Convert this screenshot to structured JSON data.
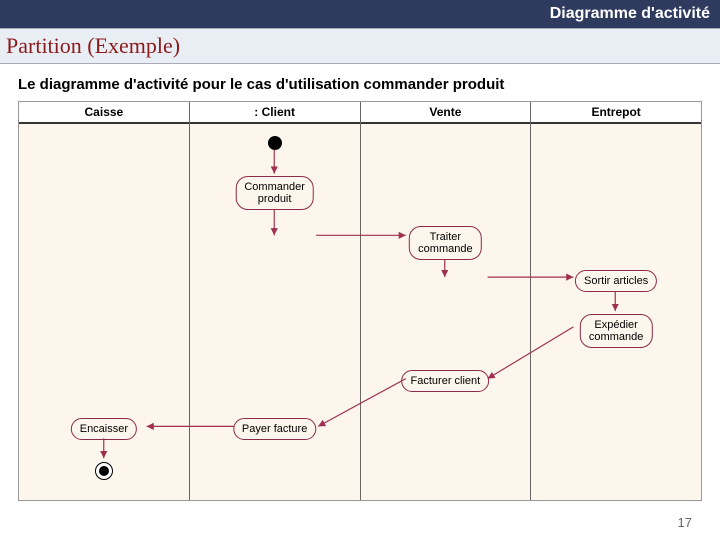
{
  "header": {
    "top_right": "Diagramme d'activité",
    "title": "Partition (Exemple)"
  },
  "subtitle": "Le diagramme d'activité pour le cas d'utilisation commander produit",
  "lanes": {
    "l0": "Caisse",
    "l1": ": Client",
    "l2": "Vente",
    "l3": "Entrepot"
  },
  "activities": {
    "commander": "Commander\nproduit",
    "traiter": "Traiter\ncommande",
    "sortir": "Sortir articles",
    "expedier": "Expédier\ncommande",
    "facturer": "Facturer client",
    "payer": "Payer facture",
    "encaisser": "Encaisser"
  },
  "page_number": "17",
  "diagram": {
    "description": "UML activity diagram with 4 swimlanes showing order processing flow",
    "flow": [
      [
        "start",
        "Client"
      ],
      [
        "Commander produit",
        "Client"
      ],
      [
        "Traiter commande",
        "Vente"
      ],
      [
        "Sortir articles",
        "Entrepot"
      ],
      [
        "Expédier commande",
        "Entrepot"
      ],
      [
        "Facturer client",
        "Vente"
      ],
      [
        "Payer facture",
        "Client"
      ],
      [
        "Encaisser",
        "Caisse"
      ],
      [
        "end",
        "Caisse"
      ]
    ]
  }
}
